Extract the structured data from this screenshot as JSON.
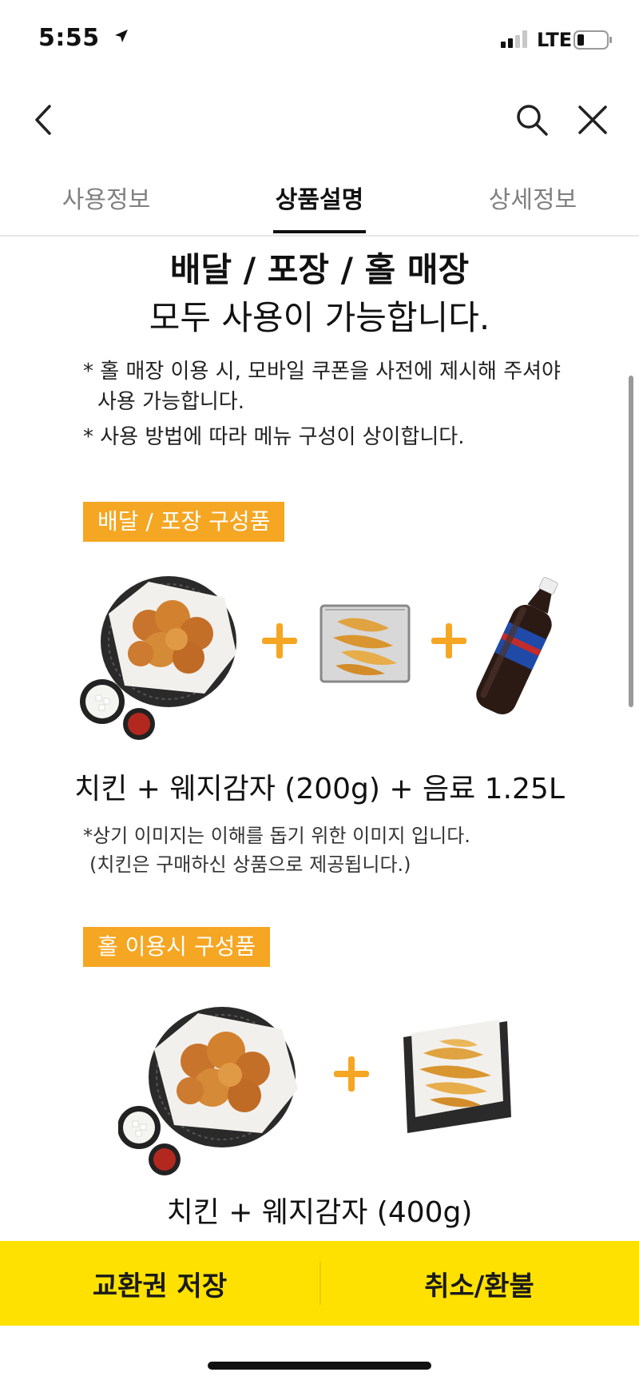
{
  "status_bar": {
    "time": "5:55",
    "network": "LTE"
  },
  "tabs": [
    {
      "label": "사용정보"
    },
    {
      "label": "상품설명"
    },
    {
      "label": "상세정보"
    }
  ],
  "active_tab_index": 1,
  "content": {
    "headline_line1": "배달 / 포장 / 홀 매장",
    "headline_line2": "모두 사용이 가능합니다.",
    "notes": [
      "* 홀 매장 이용 시, 모바일 쿠폰을 사전에 제시해 주셔야",
      "사용 가능합니다.",
      "* 사용 방법에 따라 메뉴 구성이 상이합니다."
    ],
    "section1": {
      "badge": "배달 / 포장 구성품",
      "caption": "치킨 + 웨지감자 (200g) + 음료 1.25L",
      "notes": [
        "*상기 이미지는 이해를 돕기 위한 이미지 입니다.",
        "(치킨은 구매하신 상품으로 제공됩니다.)"
      ]
    },
    "section2": {
      "badge": "홀 이용시 구성품",
      "caption": "치킨 + 웨지감자 (400g)"
    }
  },
  "bottom_bar": {
    "save_label": "교환권 저장",
    "refund_label": "취소/환불"
  },
  "colors": {
    "accent_orange": "#f5a623",
    "bottom_bar_yellow": "#ffe100"
  },
  "icons": [
    "location-arrow-icon",
    "signal-icon",
    "battery-icon",
    "back-chevron-icon",
    "search-icon",
    "close-icon"
  ]
}
